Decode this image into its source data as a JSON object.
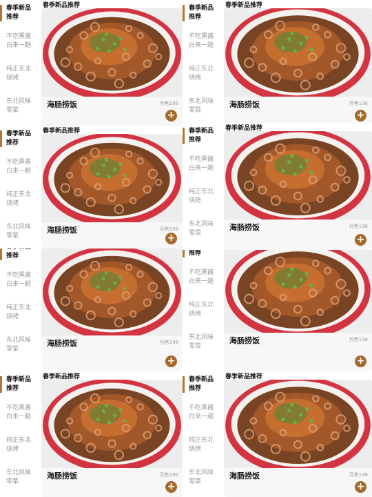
{
  "categories": [
    {
      "label": "春季新品推荐",
      "active": true
    },
    {
      "label": "不吃熏酱白来一趟",
      "active": false
    },
    {
      "label": "纯正东北烧烤",
      "active": false
    },
    {
      "label": "东北风味零菜",
      "active": false
    }
  ],
  "section_title": "春季新品推荐",
  "item": {
    "name": "海肠捞饭",
    "sales": "月售196",
    "add_icon": "plus-icon",
    "add_label": "+"
  },
  "colors": {
    "accent": "#a46a2c",
    "bowl_rim": "#c81f2a",
    "sauce": "#7a3c16"
  }
}
